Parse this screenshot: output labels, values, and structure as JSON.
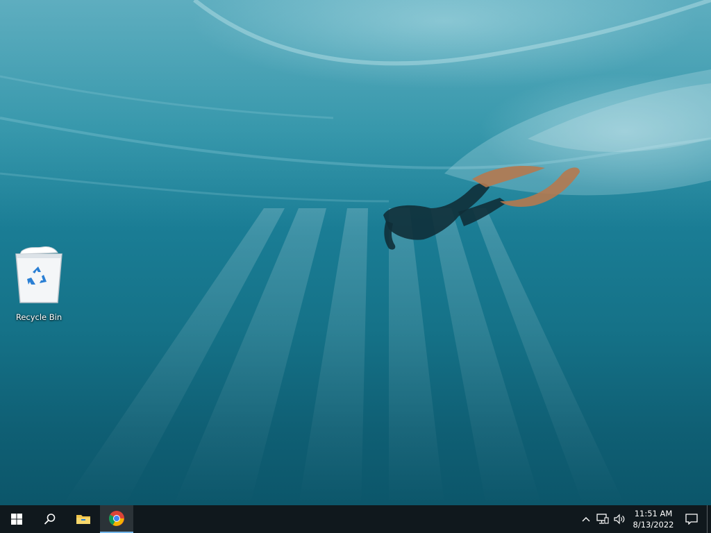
{
  "desktop": {
    "icons": [
      {
        "label": "Recycle Bin",
        "icon": "recycle-bin-icon"
      }
    ]
  },
  "taskbar": {
    "buttons": [
      {
        "name": "start",
        "icon": "windows-logo-icon"
      },
      {
        "name": "search",
        "icon": "search-icon"
      },
      {
        "name": "file-explorer",
        "icon": "folder-icon"
      },
      {
        "name": "chrome",
        "icon": "chrome-icon",
        "active": true
      }
    ],
    "tray": {
      "icons": [
        "chevron-up-icon",
        "network-icon",
        "volume-icon"
      ],
      "time": "11:51 AM",
      "date": "8/13/2022",
      "notification_icon": "notification-icon"
    }
  },
  "colors": {
    "taskbar_bg": "#10181d",
    "active_tab_bg": "#2b3338",
    "active_underline": "#76b9ed",
    "water_top": "#2a8fa6",
    "water_bottom": "#0c566a"
  }
}
